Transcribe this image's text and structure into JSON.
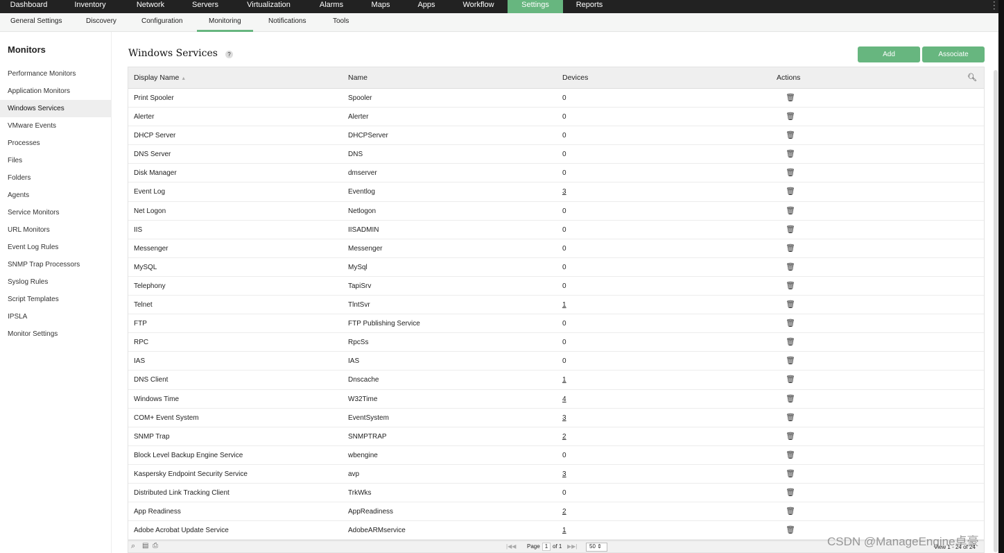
{
  "topnav": [
    "Dashboard",
    "Inventory",
    "Network",
    "Servers",
    "Virtualization",
    "Alarms",
    "Maps",
    "Apps",
    "Workflow",
    "Settings",
    "Reports"
  ],
  "topnav_active": "Settings",
  "subnav": [
    "General Settings",
    "Discovery",
    "Configuration",
    "Monitoring",
    "Notifications",
    "Tools"
  ],
  "subnav_active": "Monitoring",
  "sidebar": {
    "title": "Monitors",
    "items": [
      "Performance Monitors",
      "Application Monitors",
      "Windows Services",
      "VMware Events",
      "Processes",
      "Files",
      "Folders",
      "Agents",
      "Service Monitors",
      "URL Monitors",
      "Event Log Rules",
      "SNMP Trap Processors",
      "Syslog Rules",
      "Script Templates",
      "IPSLA",
      "Monitor Settings"
    ],
    "active": "Windows Services"
  },
  "page": {
    "title": "Windows Services",
    "help": "?",
    "add_label": "Add",
    "associate_label": "Associate"
  },
  "table": {
    "columns": [
      "Display Name",
      "Name",
      "Devices",
      "Actions"
    ],
    "rows": [
      [
        "Print Spooler",
        "Spooler",
        "0"
      ],
      [
        "Alerter",
        "Alerter",
        "0"
      ],
      [
        "DHCP Server",
        "DHCPServer",
        "0"
      ],
      [
        "DNS Server",
        "DNS",
        "0"
      ],
      [
        "Disk Manager",
        "dmserver",
        "0"
      ],
      [
        "Event Log",
        "Eventlog",
        "3"
      ],
      [
        "Net Logon",
        "Netlogon",
        "0"
      ],
      [
        "IIS",
        "IISADMIN",
        "0"
      ],
      [
        "Messenger",
        "Messenger",
        "0"
      ],
      [
        "MySQL",
        "MySql",
        "0"
      ],
      [
        "Telephony",
        "TapiSrv",
        "0"
      ],
      [
        "Telnet",
        "TlntSvr",
        "1"
      ],
      [
        "FTP",
        "FTP Publishing Service",
        "0"
      ],
      [
        "RPC",
        "RpcSs",
        "0"
      ],
      [
        "IAS",
        "IAS",
        "0"
      ],
      [
        "DNS Client",
        "Dnscache",
        "1"
      ],
      [
        "Windows Time",
        "W32Time",
        "4"
      ],
      [
        "COM+ Event System",
        "EventSystem",
        "3"
      ],
      [
        "SNMP Trap",
        "SNMPTRAP",
        "2"
      ],
      [
        "Block Level Backup Engine Service",
        "wbengine",
        "0"
      ],
      [
        "Kaspersky Endpoint Security Service",
        "avp",
        "3"
      ],
      [
        "Distributed Link Tracking Client",
        "TrkWks",
        "0"
      ],
      [
        "App Readiness",
        "AppReadiness",
        "2"
      ],
      [
        "Adobe Acrobat Update Service",
        "AdobeARMservice",
        "1"
      ]
    ]
  },
  "pager": {
    "page_label": "Page",
    "page": "1",
    "of": "of 1",
    "page_size": "50",
    "view": "View 1 - 24 of 24"
  },
  "watermark": "CSDN @ManageEngine卓豪",
  "colors": {
    "accent": "#67b67f",
    "nav": "#222222"
  }
}
